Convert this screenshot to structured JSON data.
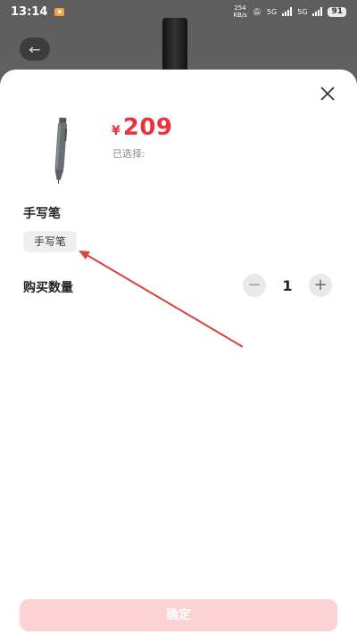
{
  "status_bar": {
    "time": "13:14",
    "net_speed_value": "254",
    "net_speed_unit": "KB/s",
    "sig1_label": "5G",
    "sig2_label": "5G",
    "battery": "91"
  },
  "product": {
    "currency": "¥",
    "price": "209",
    "selected_label": "已选择:"
  },
  "spec": {
    "title": "手写笔",
    "options": [
      "手写笔"
    ]
  },
  "quantity": {
    "title": "购买数量",
    "value": "1",
    "minus": "−",
    "plus": "+"
  },
  "confirm_label": "确定",
  "colors": {
    "price": "#e8333e",
    "confirm_bg": "#fcd2d2",
    "annotation_arrow": "#d9443f"
  }
}
